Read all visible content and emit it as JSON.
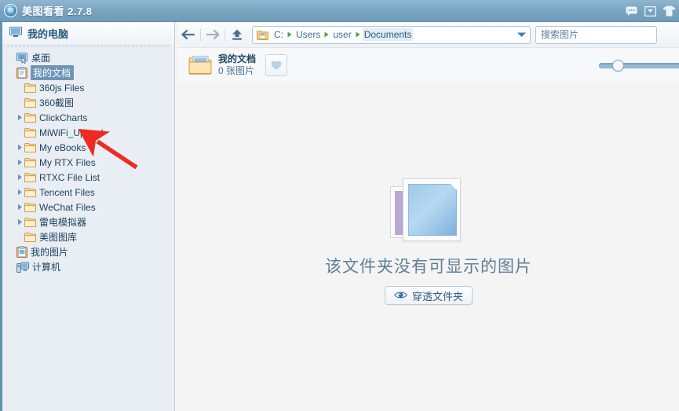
{
  "window": {
    "title": "美图看看 2.7.8",
    "logo_glyph": "看",
    "icons": [
      {
        "name": "feedback-icon",
        "label": "反馈"
      },
      {
        "name": "message-icon",
        "label": "消息"
      },
      {
        "name": "skin-icon",
        "label": "换肤"
      }
    ]
  },
  "sidebar": {
    "header": {
      "label": "我的电脑",
      "icon": "computer-icon"
    },
    "items": [
      {
        "label": "桌面",
        "icon": "desktop-icon",
        "depth": 0,
        "twisty": false,
        "selected": false
      },
      {
        "label": "我的文档",
        "icon": "documents-icon",
        "depth": 0,
        "twisty": false,
        "selected": true
      },
      {
        "label": "360js Files",
        "icon": "folder-icon",
        "depth": 1,
        "twisty": false,
        "selected": false
      },
      {
        "label": "360截图",
        "icon": "folder-icon",
        "depth": 1,
        "twisty": false,
        "selected": false
      },
      {
        "label": "ClickCharts",
        "icon": "folder-icon",
        "depth": 1,
        "twisty": true,
        "selected": false
      },
      {
        "label": "MiWiFi_Upload",
        "icon": "folder-icon",
        "depth": 1,
        "twisty": false,
        "selected": false
      },
      {
        "label": "My eBooks",
        "icon": "folder-icon",
        "depth": 1,
        "twisty": true,
        "selected": false
      },
      {
        "label": "My RTX Files",
        "icon": "folder-icon",
        "depth": 1,
        "twisty": true,
        "selected": false
      },
      {
        "label": "RTXC File List",
        "icon": "folder-icon",
        "depth": 1,
        "twisty": true,
        "selected": false
      },
      {
        "label": "Tencent Files",
        "icon": "folder-icon",
        "depth": 1,
        "twisty": true,
        "selected": false
      },
      {
        "label": "WeChat Files",
        "icon": "folder-icon",
        "depth": 1,
        "twisty": true,
        "selected": false
      },
      {
        "label": "雷电模拟器",
        "icon": "folder-icon",
        "depth": 1,
        "twisty": true,
        "selected": false
      },
      {
        "label": "美图图库",
        "icon": "folder-icon",
        "depth": 1,
        "twisty": false,
        "selected": false
      },
      {
        "label": "我的图片",
        "icon": "pictures-icon",
        "depth": 0,
        "twisty": false,
        "selected": false
      },
      {
        "label": "计算机",
        "icon": "computer-icon",
        "depth": 0,
        "twisty": false,
        "selected": false
      }
    ]
  },
  "toolbar": {
    "back_label": "后退",
    "forward_label": "前进",
    "up_label": "向上",
    "breadcrumbs": [
      "C:",
      "Users",
      "user",
      "Documents"
    ],
    "breadcrumb_active_index": 3,
    "search": {
      "value": "",
      "placeholder": "搜索图片"
    }
  },
  "folder_header": {
    "title": "我的文档",
    "subtitle": "0 张图片",
    "favorite_label": "收藏",
    "zoom_value": 12
  },
  "empty_state": {
    "message": "该文件夹没有可显示的图片",
    "button_label": "穿透文件夹"
  },
  "annotation": {
    "type": "arrow",
    "color": "#ee2b22",
    "points_to": "MiWiFi_Upload"
  },
  "colors": {
    "titlebar": "#79a4c1",
    "sidebar_bg": "#e8eef4",
    "accent_blue": "#5f94b5",
    "selection": "#6e95b5",
    "annotation_red": "#ee2b22"
  }
}
